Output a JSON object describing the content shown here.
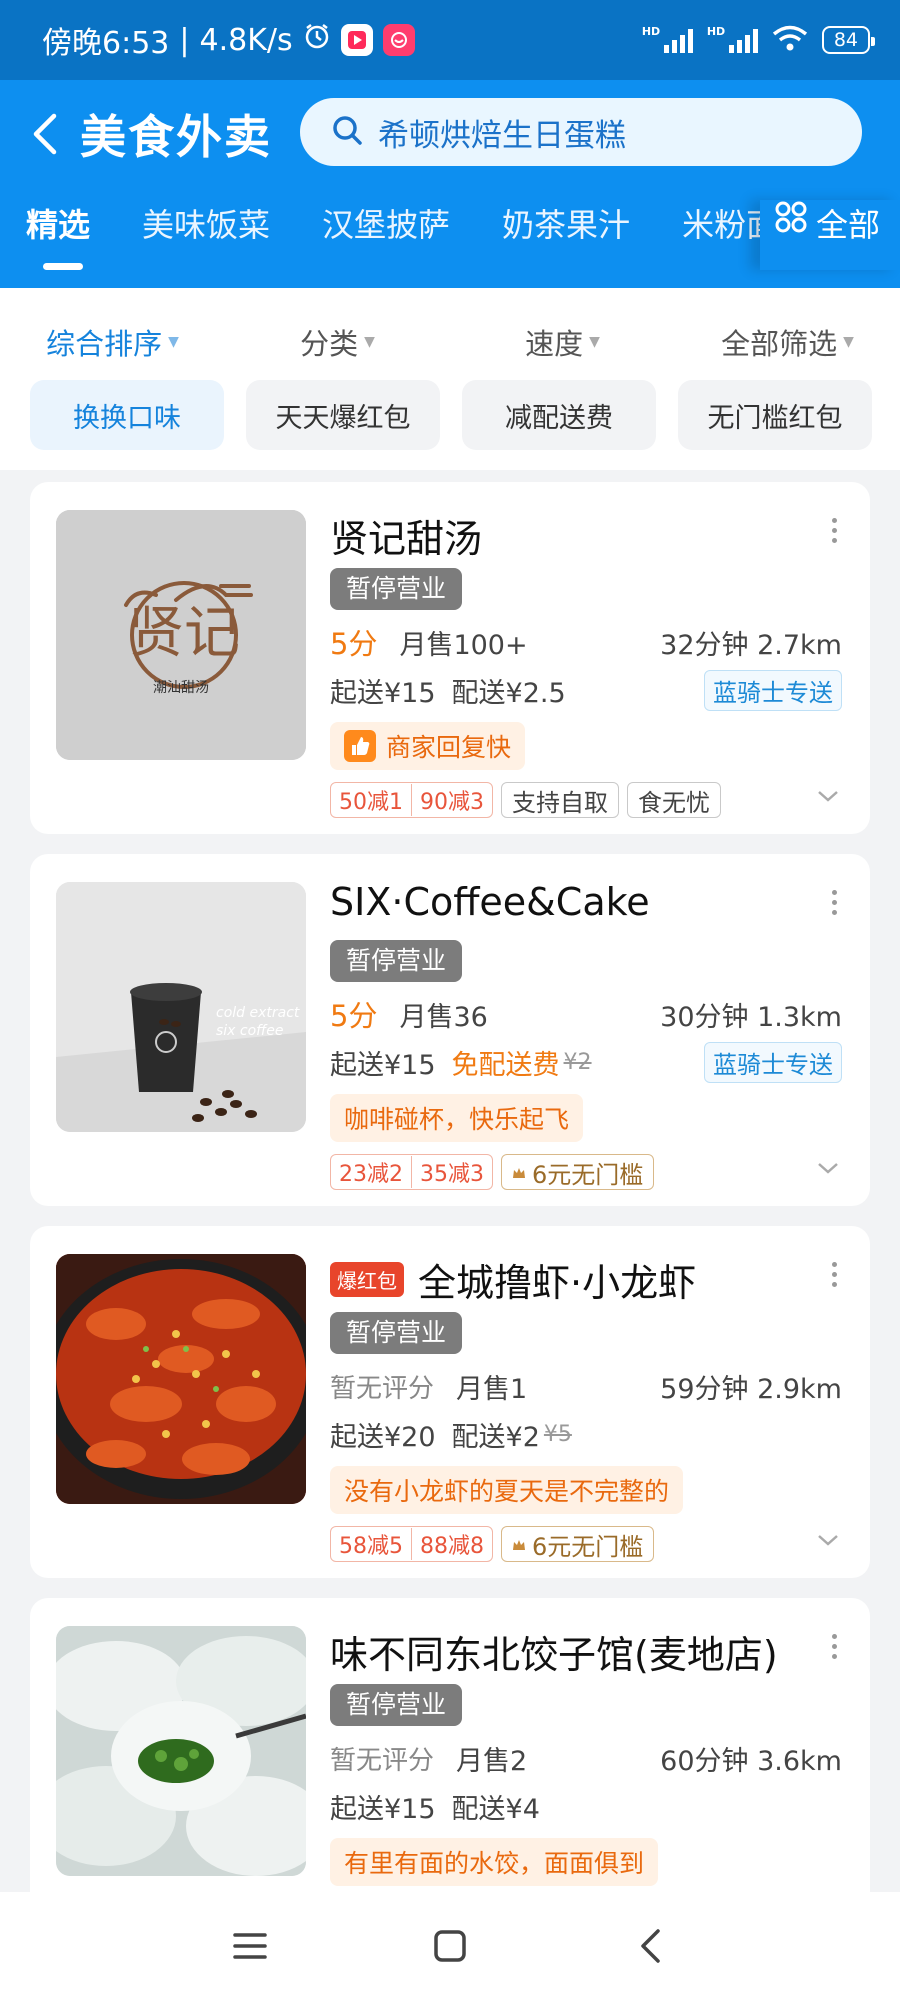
{
  "status_bar": {
    "time": "傍晚6:53",
    "net_speed": "4.8K/s",
    "battery": "84"
  },
  "header": {
    "title": "美食外卖",
    "search_text": "希顿烘焙生日蛋糕",
    "tabs": [
      "精选",
      "美味饭菜",
      "汉堡披萨",
      "奶茶果汁",
      "米粉面"
    ],
    "all_label": "全部"
  },
  "sort": {
    "items": [
      "综合排序",
      "分类",
      "速度",
      "全部筛选"
    ]
  },
  "chips": [
    "换换口味",
    "天天爆红包",
    "减配送费",
    "无门槛红包"
  ],
  "shops": [
    {
      "name": "贤记甜汤",
      "status": "暂停营业",
      "score": "5分",
      "monthly_sales": "月售100+",
      "time_dist": "32分钟  2.7km",
      "min_order": "起送¥15",
      "delivery_fee": "配送¥2.5",
      "rider_badge": "蓝骑士专送",
      "slogan": "商家回复快",
      "discounts": [
        "50减1",
        "90减3"
      ],
      "tags": [
        "支持自取",
        "食无忧"
      ],
      "logo_text": "贤记",
      "logo_sub": "潮汕甜汤"
    },
    {
      "name": "SIX·Coffee&Cake",
      "status": "暂停营业",
      "score": "5分",
      "monthly_sales": "月售36",
      "time_dist": "30分钟  1.3km",
      "min_order": "起送¥15",
      "delivery_fee": "免配送费",
      "delivery_orig": "¥2",
      "rider_badge": "蓝骑士专送",
      "slogan": "咖啡碰杯，快乐起飞",
      "discounts": [
        "23减2",
        "35减3"
      ],
      "tags": [
        "6元无门槛"
      ],
      "photo_text": "cold extract",
      "photo_text2": "six coffee"
    },
    {
      "badge": "爆红包",
      "name": "全城撸虾·小龙虾",
      "status": "暂停营业",
      "score": "暂无评分",
      "monthly_sales": "月售1",
      "time_dist": "59分钟  2.9km",
      "min_order": "起送¥20",
      "delivery_fee": "配送¥2",
      "delivery_orig": "¥5",
      "slogan": "没有小龙虾的夏天是不完整的",
      "discounts": [
        "58减5",
        "88减8"
      ],
      "tags": [
        "6元无门槛"
      ]
    },
    {
      "name": "味不同东北饺子馆(麦地店)",
      "status": "暂停营业",
      "score": "暂无评分",
      "monthly_sales": "月售2",
      "time_dist": "60分钟  3.6km",
      "min_order": "起送¥15",
      "delivery_fee": "配送¥4",
      "slogan": "有里有面的水饺，面面俱到"
    }
  ],
  "colors": {
    "header_blue": "#0d8ff0",
    "status_blue": "#0a73c4",
    "accent_orange": "#f07a12",
    "active_blue": "#1583dc"
  }
}
